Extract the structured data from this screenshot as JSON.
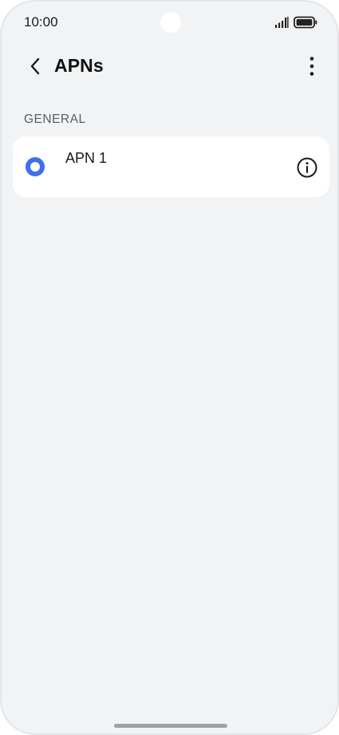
{
  "status_bar": {
    "time": "10:00",
    "icons": [
      "signal-icon",
      "battery-icon"
    ]
  },
  "header": {
    "title": "APNs",
    "back_icon": "back-arrow-icon",
    "more_icon": "more-vert-icon"
  },
  "sections": [
    {
      "header": "GENERAL",
      "items": [
        {
          "name": "APN 1",
          "selected": true,
          "info_icon": "info-icon"
        }
      ]
    }
  ],
  "colors": {
    "background": "#f2f3f5",
    "card": "#ffffff",
    "accent": "#3d6ff0",
    "text": "#1a1a1a",
    "section_text": "#5a5d62"
  }
}
